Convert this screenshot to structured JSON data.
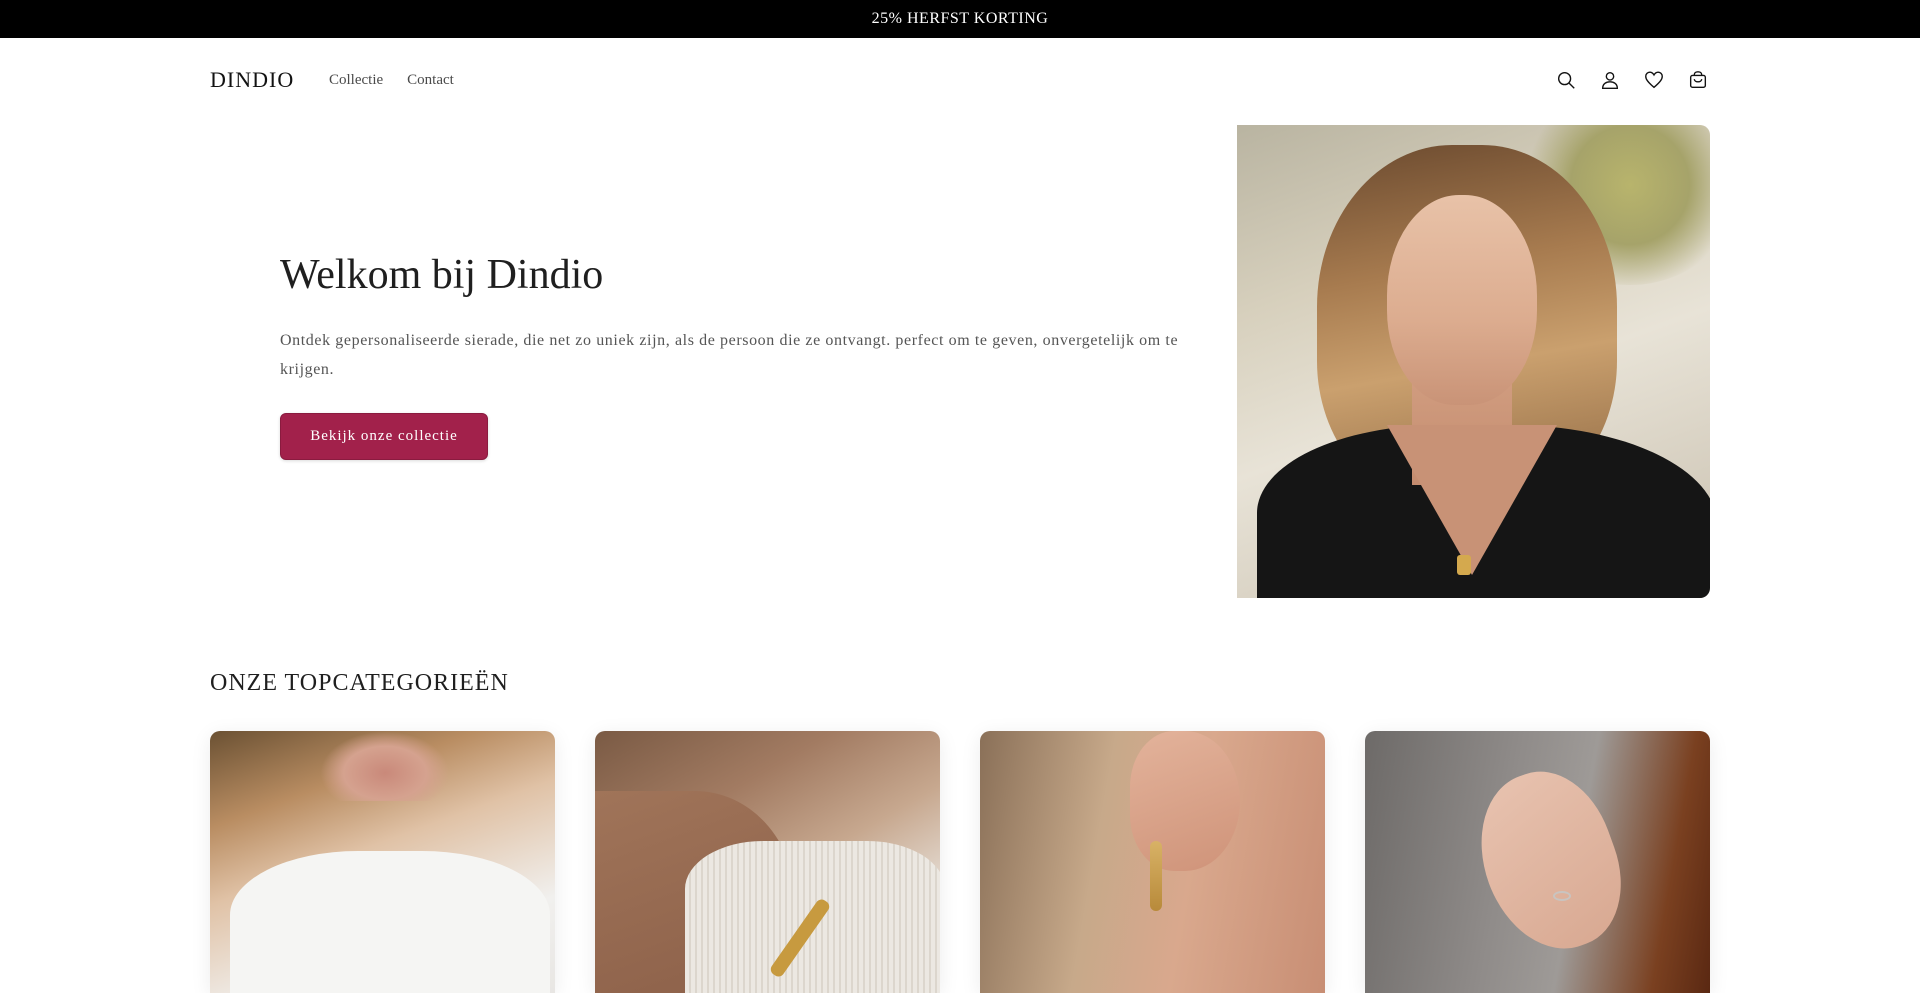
{
  "announcement": {
    "text": "25% HERFST KORTING"
  },
  "header": {
    "logo": "DINDIO",
    "nav": [
      {
        "label": "Collectie"
      },
      {
        "label": "Contact"
      }
    ],
    "icons": [
      "search-icon",
      "account-icon",
      "wishlist-icon",
      "cart-icon"
    ]
  },
  "hero": {
    "title": "Welkom bij Dindio",
    "description": "Ontdek gepersonaliseerde sierade, die net zo uniek zijn, als de persoon die ze ontvangt. perfect om te geven, onvergetelijk om te krijgen.",
    "button_label": "Bekijk onze collectie",
    "button_color": "#a2214b"
  },
  "categories": {
    "title": "ONZE TOPCATEGORIEËN"
  }
}
